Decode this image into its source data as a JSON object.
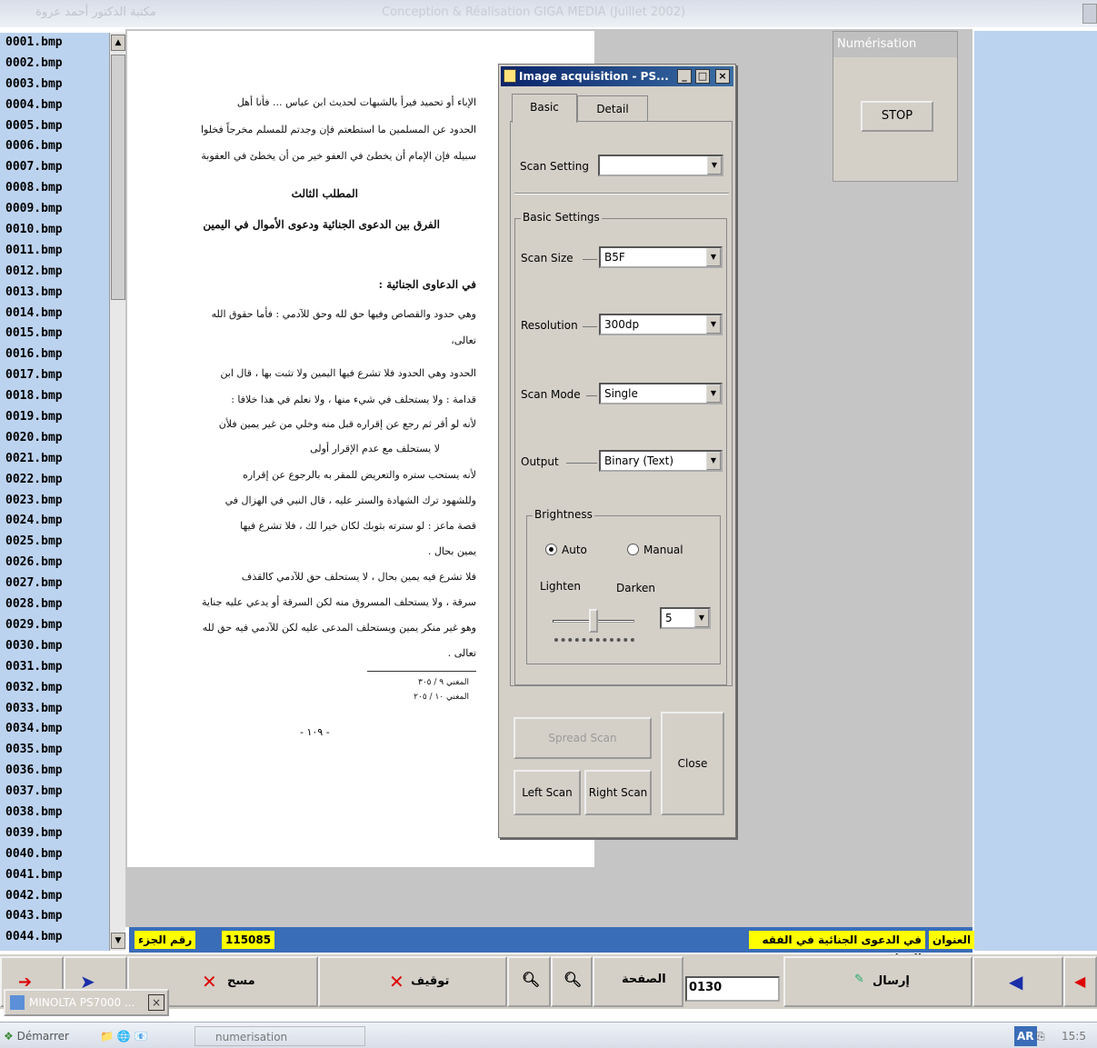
{
  "window": {
    "title_right": "مكتبة الدكتور أحمد عروة",
    "title_center": "Conception & Réalisation GIGA MEDIA (Juillet 2002)"
  },
  "files": [
    "0001.bmp",
    "0002.bmp",
    "0003.bmp",
    "0004.bmp",
    "0005.bmp",
    "0006.bmp",
    "0007.bmp",
    "0008.bmp",
    "0009.bmp",
    "0010.bmp",
    "0011.bmp",
    "0012.bmp",
    "0013.bmp",
    "0014.bmp",
    "0015.bmp",
    "0016.bmp",
    "0017.bmp",
    "0018.bmp",
    "0019.bmp",
    "0020.bmp",
    "0021.bmp",
    "0022.bmp",
    "0023.bmp",
    "0024.bmp",
    "0025.bmp",
    "0026.bmp",
    "0027.bmp",
    "0028.bmp",
    "0029.bmp",
    "0030.bmp",
    "0031.bmp",
    "0032.bmp",
    "0033.bmp",
    "0034.bmp",
    "0035.bmp",
    "0036.bmp",
    "0037.bmp",
    "0038.bmp",
    "0039.bmp",
    "0040.bmp",
    "0041.bmp",
    "0042.bmp",
    "0043.bmp",
    "0044.bmp"
  ],
  "document": {
    "lines": [
      "الإباء أو تحميد فيرأ بالشبهات لحديث ابن عباس ... فأنا أهل",
      "الحدود عن المسلمين ما استطعتم فإن وجدتم للمسلم مخرجاً فخلوا",
      "سبيله فإن الإمام أن يخطئ في العفو خير من أن يخطئ في العقوبة",
      "المطلب الثالث",
      "الفرق بين الدعوى الجنائية ودعوى الأموال في اليمين",
      "في الدعاوى الجنائية :",
      "وهي حدود والقصاص وفيها حق لله وحق للآدمي : فأما حقوق الله",
      "تعالى،",
      "الحدود وهي الحدود فلا تشرع فيها اليمين ولا تثبت بها ، قال ابن",
      "قدامة : ولا يستحلف في شيء منها ، ولا نعلم في هذا خلافا :",
      "لأنه لو أقر ثم رجع عن إقراره قبل منه وخلي من غير يمين فلأن",
      "لا يستحلف مع عدم الإقرار أولى",
      "لأنه يستحب ستره والتعريض للمقر به بالرجوع عن إقراره",
      "وللشهود ترك الشهادة والستر عليه ، قال النبي في الهزال في",
      "قصة ماعز : لو سترته بثوبك لكان خيرا لك ، فلا تشرع فيها",
      "يمين بحال .",
      "فلا تشرع فيه يمين بحال ، لا يستحلف حق للآدمي كالقذف",
      "سرقة ، ولا يستحلف المسروق منه لكن السرقة أو يدعي عليه جناية",
      "وهو غير منكر يمين ويستحلف المدعى عليه لكن للآدمي فيه حق لله",
      "تعالى ."
    ],
    "footnote_1": "المغني ٩ / ٣٠٥",
    "footnote_2": "المغني ١٠ / ٢٠٥",
    "page_number": "- ١٠٩ -"
  },
  "dialog": {
    "title": "Image acquisition - PS...",
    "tabs": [
      "Basic",
      "Detail"
    ],
    "scan_setting_label": "Scan Setting",
    "scan_setting_value": "",
    "basic_settings_title": "Basic Settings",
    "scan_size_label": "Scan Size",
    "scan_size_value": "B5F",
    "resolution_label": "Resolution",
    "resolution_value": "300dp",
    "scan_mode_label": "Scan Mode",
    "scan_mode_value": "Single",
    "output_label": "Output",
    "output_value": "Binary (Text)",
    "brightness_title": "Brightness",
    "auto_label": "Auto",
    "manual_label": "Manual",
    "lighten_label": "Lighten",
    "darken_label": "Darken",
    "brightness_value": "5",
    "brightness_level": 5,
    "spread_scan": "Spread Scan",
    "left_scan": "Left Scan",
    "right_scan": "Right Scan",
    "close": "Close"
  },
  "numerisation": {
    "title": "Numérisation",
    "stop": "STOP"
  },
  "infobar": {
    "number_label": "رقم الجزء",
    "number_value": "115085",
    "title_label": "العنوان",
    "title_value": "في الدعوى الجنائية في الفقه الإسلامي"
  },
  "toolbar": {
    "delete_label": "مسح",
    "stop_label": "توقيف",
    "page_label": "الصفحة",
    "page_value": "0130",
    "send_label": "إرسال"
  },
  "taskbar": {
    "minolta": "MINOLTA PS7000 ...",
    "start": "Démarrer",
    "task": "numerisation",
    "lang": "AR",
    "time": "15:5"
  }
}
